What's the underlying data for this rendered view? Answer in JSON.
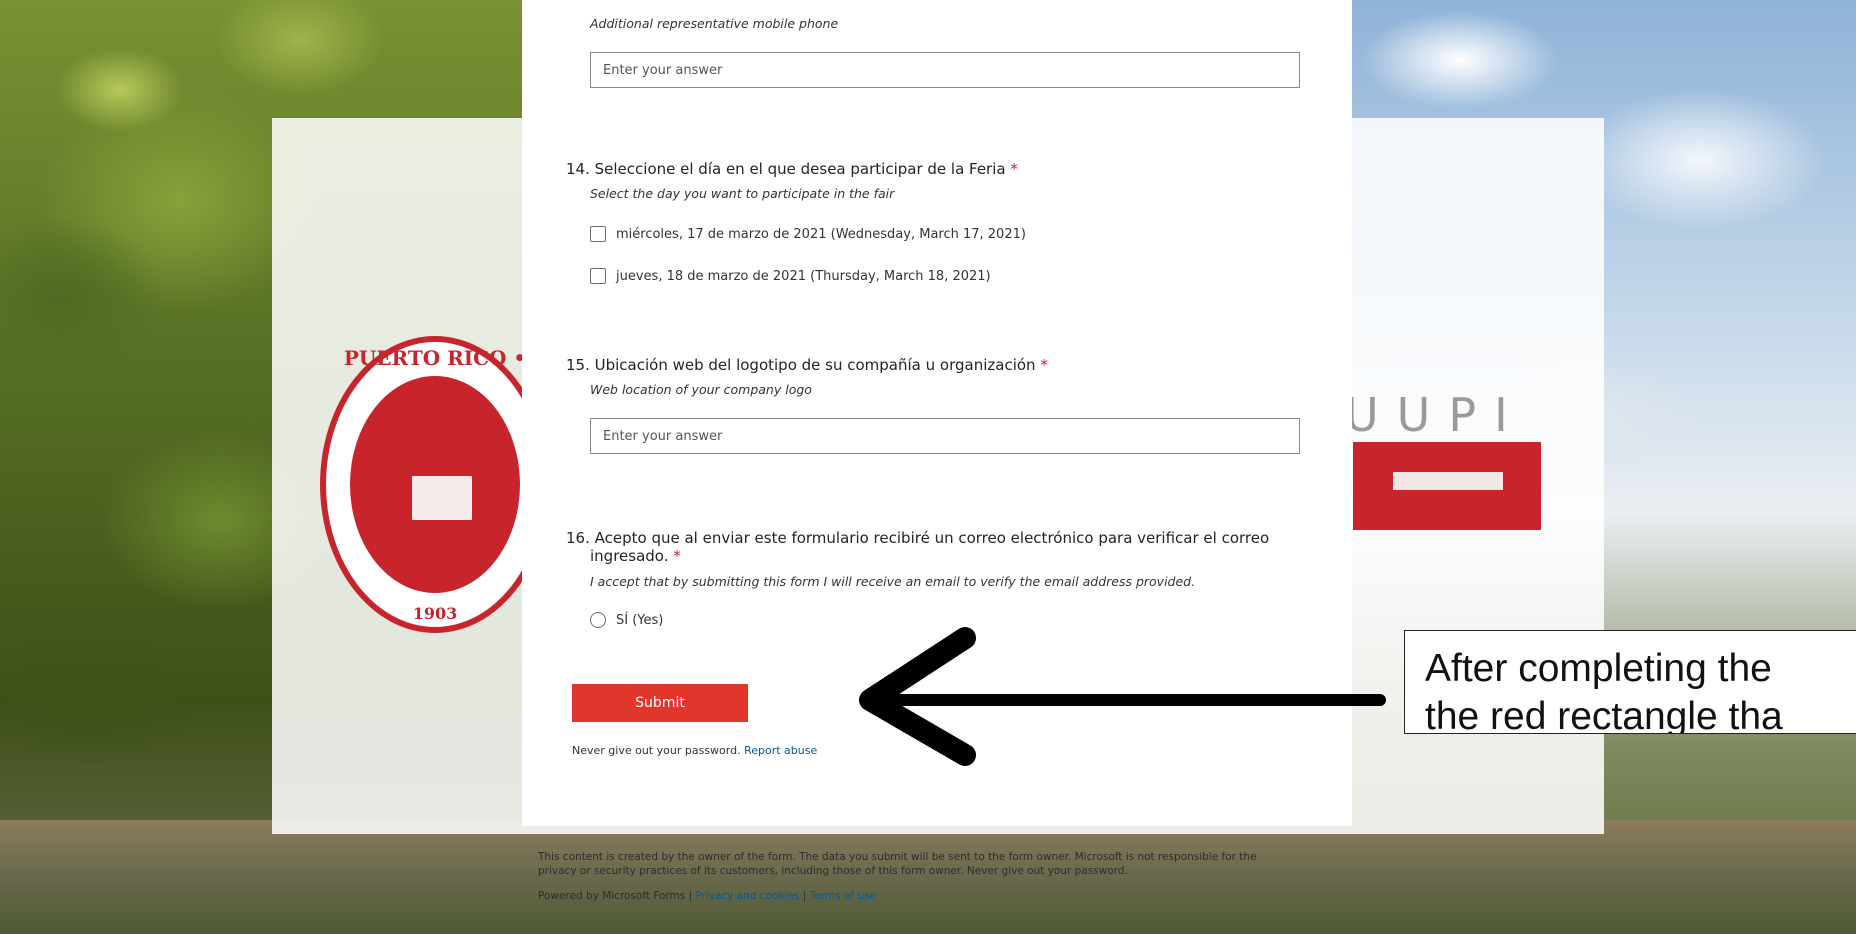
{
  "form": {
    "q13_subtitle": "Additional representative mobile phone",
    "q13_placeholder": "Enter your answer",
    "q14": {
      "number": "14.",
      "title": "Seleccione el día en el que desea participar de la Feria",
      "required": "*",
      "subtitle": "Select the day you want to participate in the fair",
      "options": [
        "miércoles, 17 de marzo de 2021 (Wednesday, March 17, 2021)",
        "jueves, 18 de marzo de 2021 (Thursday, March 18, 2021)"
      ]
    },
    "q15": {
      "number": "15.",
      "title": "Ubicación web del logotipo de su compañía u organización",
      "required": "*",
      "subtitle": "Web location of your company logo",
      "placeholder": "Enter your answer"
    },
    "q16": {
      "number": "16.",
      "title_line1": "Acepto que al enviar este formulario recibiré un correo electrónico para verificar el correo",
      "title_line2": "ingresado.",
      "required": "*",
      "subtitle": "I accept that by submitting this form I will receive an email to verify the email address provided.",
      "option": "SÍ (Yes)"
    },
    "submit_label": "Submit",
    "password_warning": "Never give out your password.",
    "report_abuse": "Report abuse"
  },
  "footer": {
    "disclaimer_line1": "This content is created by the owner of the form. The data you submit will be sent to the form owner. Microsoft is not responsible for the",
    "disclaimer_line2": "privacy or security practices of its customers, including those of this form owner. Never give out your password.",
    "powered_by": "Powered by Microsoft Forms",
    "separator": "|",
    "privacy_link": "Privacy and cookies",
    "terms_link": "Terms of use"
  },
  "background": {
    "seal_top_text": "PUERTO RICO •",
    "seal_bottom_text": "1903",
    "logo_text": "UUPI"
  },
  "annotation": {
    "line1": "After completing the",
    "line2": "the red rectangle tha"
  },
  "colors": {
    "accent": "#e0362c",
    "required": "#c8242c",
    "link": "#005a9e"
  }
}
